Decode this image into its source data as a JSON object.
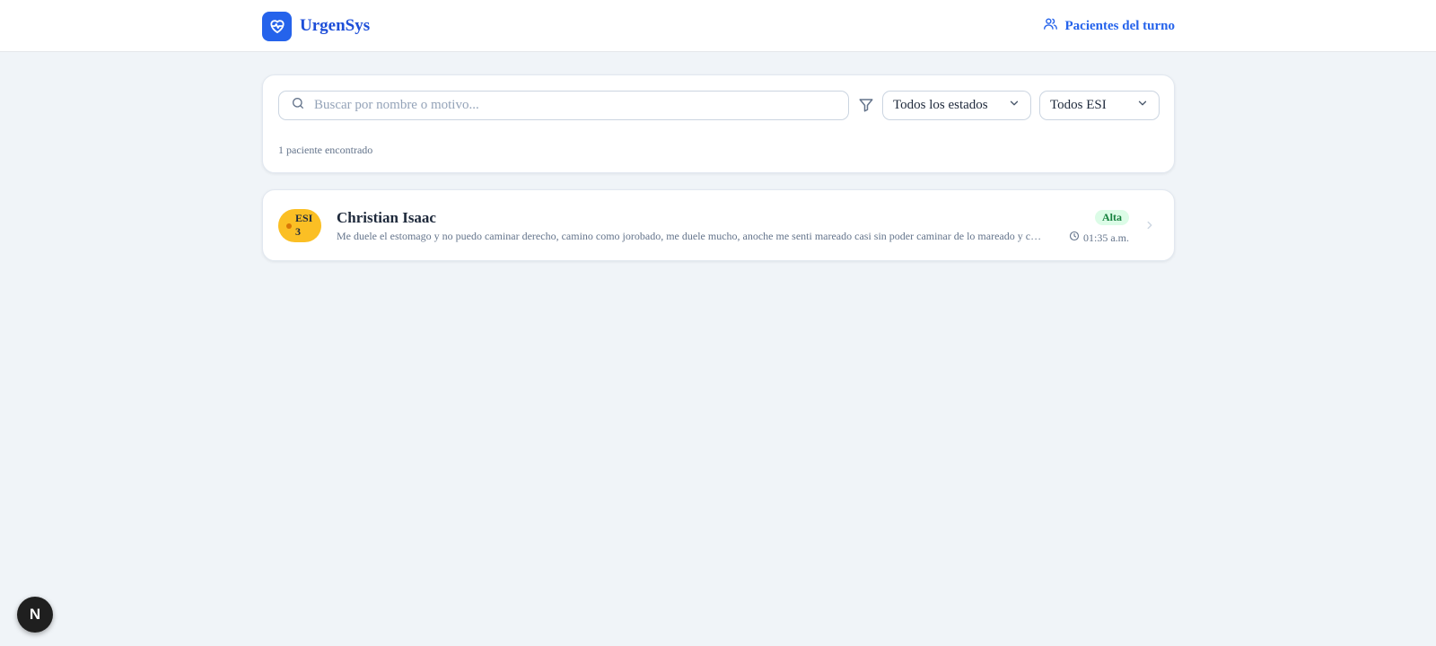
{
  "header": {
    "brand_name": "UrgenSys",
    "nav_link_label": "Pacientes del turno"
  },
  "filters": {
    "search_placeholder": "Buscar por nombre o motivo...",
    "search_value": "",
    "status_select": "Todos los estados",
    "esi_select": "Todos ESI",
    "result_count": "1 paciente encontrado"
  },
  "patients": [
    {
      "esi_label": "ESI",
      "esi_level": "3",
      "name": "Christian Isaac",
      "reason": "Me duele el estomago y no puedo caminar derecho, camino como jorobado, me duele mucho, anoche me senti mareado casi sin poder caminar de lo mareado y con mucho dolor",
      "status": "Alta",
      "time": "01:35 a.m."
    }
  ],
  "dev_tools": {
    "label": "N"
  },
  "colors": {
    "brand": "#2563eb",
    "esi_3": "#fbbf24",
    "status_alta_bg": "#dcfce7",
    "status_alta_text": "#15803d",
    "page_background": "#f0f4f8"
  },
  "icons": {
    "brand": "heart-pulse-icon",
    "nav": "users-icon",
    "search": "search-icon",
    "filter": "filter-icon",
    "select": "chevron-down-icon",
    "time": "clock-icon",
    "row": "chevron-right-icon"
  }
}
